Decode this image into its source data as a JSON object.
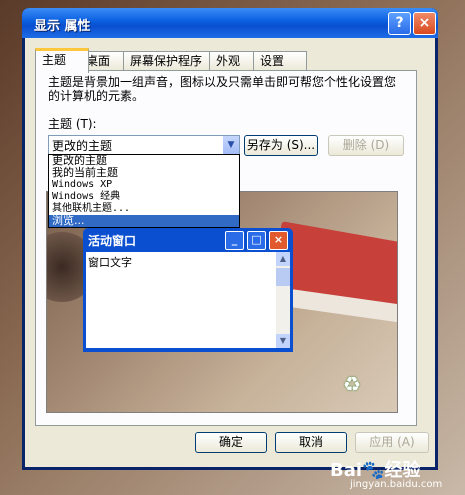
{
  "window": {
    "title": "显示 属性",
    "help": "?",
    "close": "×"
  },
  "tabs": [
    "主题",
    "桌面",
    "屏幕保护程序",
    "外观",
    "设置"
  ],
  "theme_page": {
    "description": "主题是背景加一组声音，图标以及只需单击即可帮您个性化设置您的计算机的元素。",
    "theme_label": "主题 (T):",
    "selected_theme": "更改的主题",
    "save_as": "另存为 (S)...",
    "delete": "删除 (D)",
    "options": [
      "更改的主题",
      "我的当前主题",
      "Windows XP",
      "Windows 经典",
      "其他联机主题...",
      "浏览..."
    ]
  },
  "preview": {
    "window_title": "活动窗口",
    "window_text": "窗口文字"
  },
  "footer": {
    "ok": "确定",
    "cancel": "取消",
    "apply": "应用 (A)"
  },
  "watermark": {
    "brand": "Bai",
    "brand2": "经验",
    "url": "jingyan.baidu.com"
  }
}
